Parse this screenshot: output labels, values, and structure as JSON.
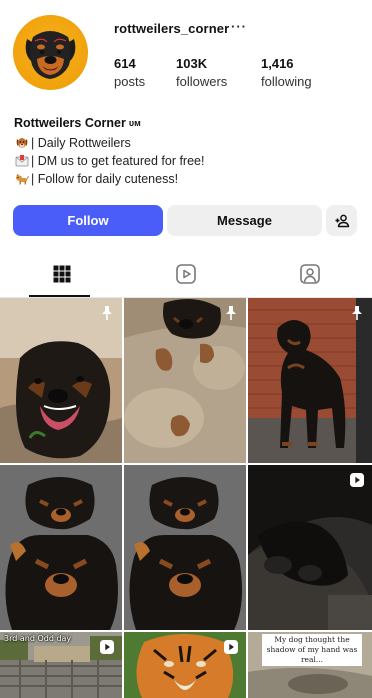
{
  "profile": {
    "username": "rottweilers_corner",
    "more_icon": "···"
  },
  "stats": {
    "posts_count": "614",
    "posts_label": "posts",
    "followers_count": "103K",
    "followers_label": "followers",
    "following_count": "1,416",
    "following_label": "following"
  },
  "bio": {
    "name": "Rottweilers Corner",
    "name_tag": "ᴜᴍ",
    "lines": [
      {
        "icon": "dog-face-icon",
        "text": "| Daily Rottweilers"
      },
      {
        "icon": "envelope-icon",
        "text": "| DM us to get featured for free!"
      },
      {
        "icon": "dog-icon",
        "text": "| Follow for daily cuteness!"
      }
    ]
  },
  "actions": {
    "follow_label": "Follow",
    "message_label": "Message",
    "add_user_icon": "add-user-icon"
  },
  "tabs": [
    {
      "name": "posts",
      "icon": "grid-icon",
      "active": true
    },
    {
      "name": "reels",
      "icon": "reels-icon",
      "active": false
    },
    {
      "name": "tagged",
      "icon": "tagged-icon",
      "active": false
    }
  ],
  "grid": {
    "captions": {
      "post7": "3rd and Odd day",
      "post9": "My dog thought the shadow of my hand was real..."
    }
  },
  "colors": {
    "follow_button": "#4a5df9",
    "secondary_button": "#efefef",
    "avatar_bg": "#f0a20c"
  }
}
